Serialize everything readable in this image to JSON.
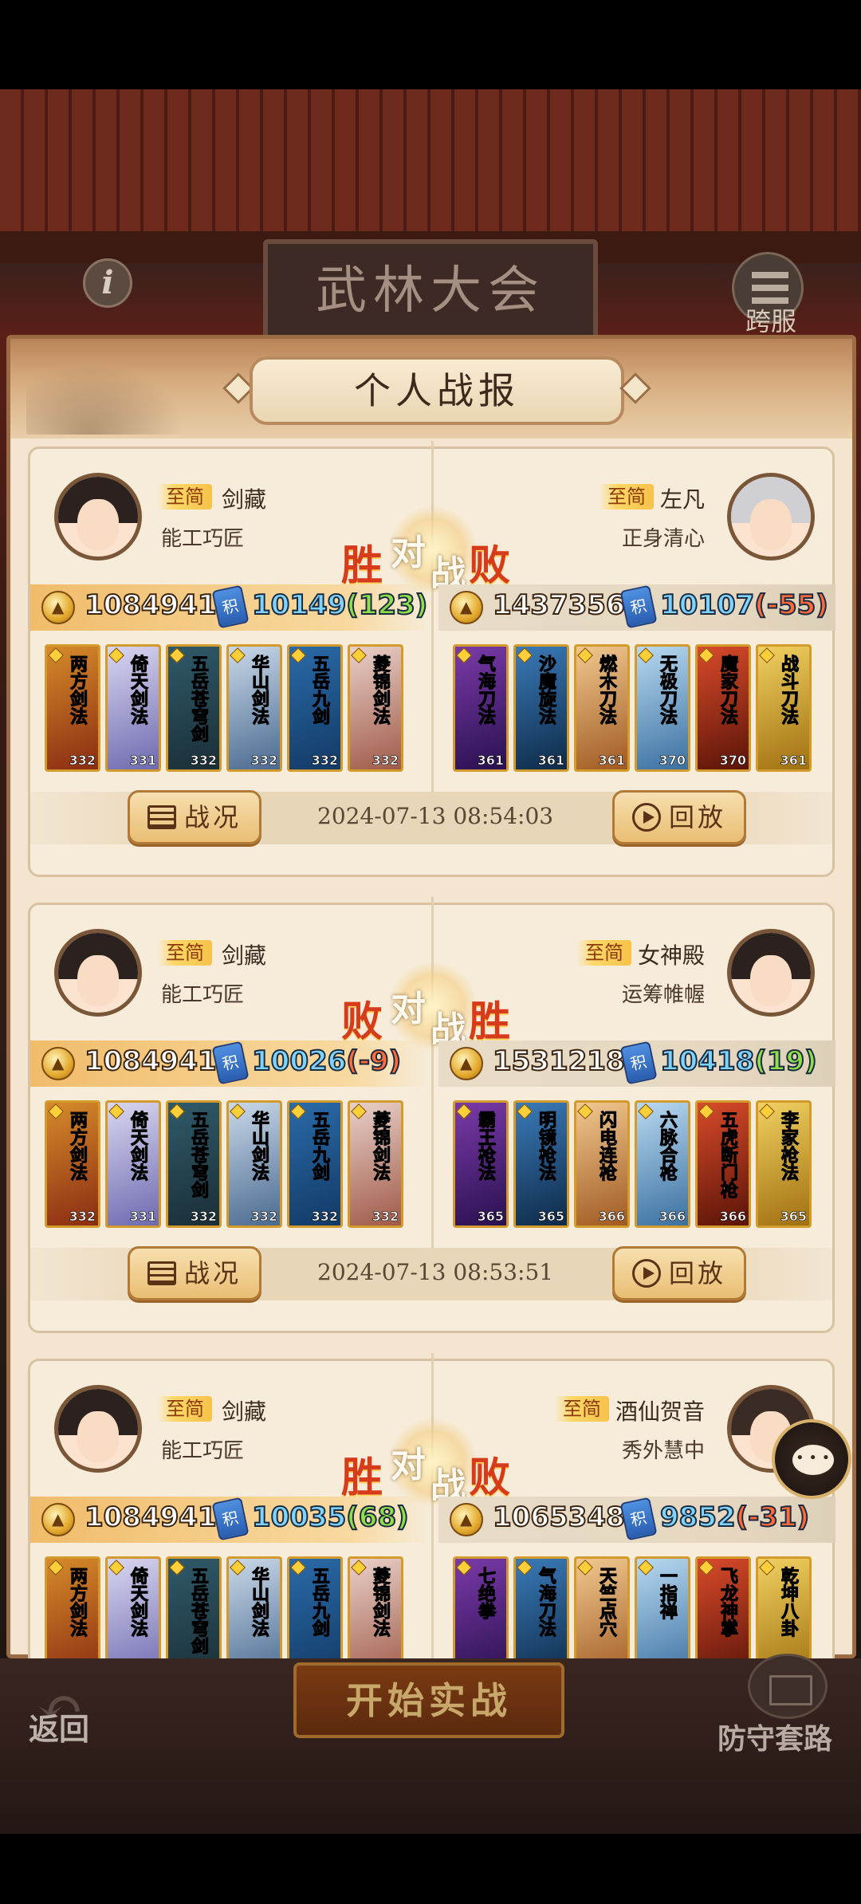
{
  "header": {
    "signboard": "武林大会",
    "info_icon": "info-icon",
    "cross_server_label": "跨服"
  },
  "panel": {
    "title": "个人战报"
  },
  "vs_chars": {
    "mid1": "对",
    "mid2": "战"
  },
  "battles": [
    {
      "left": {
        "tag": "至简",
        "name": "剑藏",
        "title": "能工巧匠",
        "power": "1084941",
        "score_base": "10149",
        "score_delta": "(123)",
        "delta_sign": "pos",
        "result": "胜",
        "skills": [
          {
            "name": "两方剑法",
            "lv": "332"
          },
          {
            "name": "倚天剑法",
            "lv": "331"
          },
          {
            "name": "五岳苍穹剑",
            "lv": "332"
          },
          {
            "name": "华山剑法",
            "lv": "332"
          },
          {
            "name": "五岳九剑",
            "lv": "332"
          },
          {
            "name": "菱锦剑法",
            "lv": "332"
          }
        ]
      },
      "right": {
        "tag": "至简",
        "name": "左凡",
        "title": "正身清心",
        "power": "1437356",
        "score_base": "10107",
        "score_delta": "(-55)",
        "delta_sign": "neg",
        "result": "败",
        "skills": [
          {
            "name": "气海刀法",
            "lv": "361"
          },
          {
            "name": "沙魔旋法",
            "lv": "361"
          },
          {
            "name": "燃木刀法",
            "lv": "361"
          },
          {
            "name": "无极刀法",
            "lv": "370"
          },
          {
            "name": "魔家刀法",
            "lv": "370"
          },
          {
            "name": "战斗刀法",
            "lv": "361"
          }
        ]
      },
      "timestamp": "2024-07-13 08:54:03"
    },
    {
      "left": {
        "tag": "至简",
        "name": "剑藏",
        "title": "能工巧匠",
        "power": "1084941",
        "score_base": "10026",
        "score_delta": "(-9)",
        "delta_sign": "neg",
        "result": "败",
        "skills": [
          {
            "name": "两方剑法",
            "lv": "332"
          },
          {
            "name": "倚天剑法",
            "lv": "331"
          },
          {
            "name": "五岳苍穹剑",
            "lv": "332"
          },
          {
            "name": "华山剑法",
            "lv": "332"
          },
          {
            "name": "五岳九剑",
            "lv": "332"
          },
          {
            "name": "菱锦剑法",
            "lv": "332"
          }
        ]
      },
      "right": {
        "tag": "至简",
        "name": "女神殿",
        "title": "运筹帷幄",
        "power": "1531218",
        "score_base": "10418",
        "score_delta": "(19)",
        "delta_sign": "pos",
        "result": "胜",
        "skills": [
          {
            "name": "霸王枪法",
            "lv": "365"
          },
          {
            "name": "明镜枪法",
            "lv": "365"
          },
          {
            "name": "闪电连枪",
            "lv": "366"
          },
          {
            "name": "六脉合枪",
            "lv": "366"
          },
          {
            "name": "五虎断门枪",
            "lv": "366"
          },
          {
            "name": "李家枪法",
            "lv": "365"
          }
        ]
      },
      "timestamp": "2024-07-13 08:53:51"
    },
    {
      "left": {
        "tag": "至简",
        "name": "剑藏",
        "title": "能工巧匠",
        "power": "1084941",
        "score_base": "10035",
        "score_delta": "(68)",
        "delta_sign": "pos",
        "result": "胜",
        "skills": [
          {
            "name": "两方剑法",
            "lv": ""
          },
          {
            "name": "倚天剑法",
            "lv": ""
          },
          {
            "name": "五岳苍穹剑",
            "lv": ""
          },
          {
            "name": "华山剑法",
            "lv": ""
          },
          {
            "name": "五岳九剑",
            "lv": ""
          },
          {
            "name": "菱锦剑法",
            "lv": ""
          }
        ]
      },
      "right": {
        "tag": "至简",
        "name": "酒仙贺音",
        "title": "秀外慧中",
        "power": "1065348",
        "score_base": "9852",
        "score_delta": "(-31)",
        "delta_sign": "neg",
        "result": "败",
        "skills": [
          {
            "name": "七绝拳",
            "lv": ""
          },
          {
            "name": "气海刀法",
            "lv": ""
          },
          {
            "name": "天竺点穴",
            "lv": ""
          },
          {
            "name": "一指禅",
            "lv": ""
          },
          {
            "name": "飞龙神掌",
            "lv": ""
          },
          {
            "name": "乾坤八卦",
            "lv": ""
          }
        ]
      },
      "timestamp": ""
    }
  ],
  "buttons": {
    "situation": "战况",
    "replay": "回放",
    "back": "返回",
    "start": "开始实战",
    "defense": "防守套路"
  },
  "icons": {
    "chat": "chat-icon",
    "book": "book-icon"
  },
  "colors": {
    "panel_bg": "#f3e5cf",
    "accent_gold": "#e9be74",
    "win_red": "#d63b1c",
    "score_positive": "#8ee04a",
    "score_negative": "#ff6a3a"
  }
}
